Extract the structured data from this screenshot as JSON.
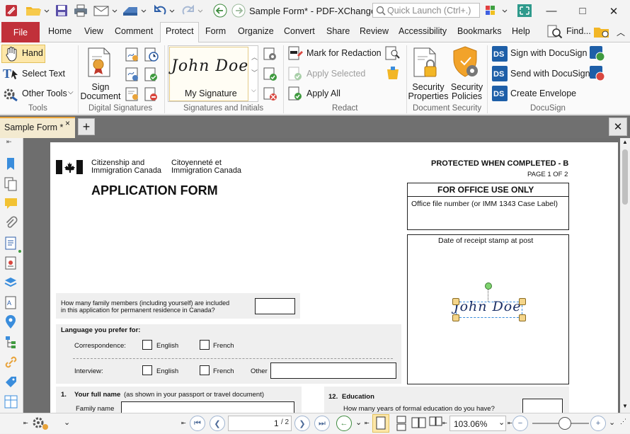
{
  "window": {
    "title": "Sample Form* - PDF-XChange ..",
    "quick_launch_placeholder": "Quick Launch (Ctrl+.)",
    "minimize": "—",
    "maximize": "□",
    "close": "✕"
  },
  "menu": {
    "file": "File",
    "tabs": [
      "Home",
      "View",
      "Comment",
      "Protect",
      "Form",
      "Organize",
      "Convert",
      "Share",
      "Review",
      "Accessibility",
      "Bookmarks",
      "Help"
    ],
    "find": "Find...",
    "active_tab": "Protect"
  },
  "ribbon": {
    "tools": {
      "hand": "Hand",
      "select_text": "Select Text",
      "other_tools": "Other Tools",
      "label": "Tools"
    },
    "digital_signatures": {
      "sign_document": "Sign Document",
      "label": "Digital Signatures"
    },
    "signatures": {
      "my_signature": "My Signature",
      "preview_text": "John Doe",
      "label": "Signatures and Initials"
    },
    "redact": {
      "mark": "Mark for Redaction",
      "apply_selected": "Apply Selected",
      "apply_all": "Apply All",
      "label": "Redact"
    },
    "security": {
      "properties": "Security Properties",
      "policies": "Security Policies",
      "label": "Document Security"
    },
    "docusign": {
      "sign": "Sign with DocuSign",
      "send": "Send with DocuSign",
      "create": "Create Envelope",
      "label": "DocuSign"
    }
  },
  "doc_tab": {
    "name": "Sample Form *",
    "close": "×",
    "new_tab": "+",
    "close_all": "✕"
  },
  "form": {
    "dept_en_1": "Citizenship and",
    "dept_en_2": "Immigration Canada",
    "dept_fr_1": "Citoyenneté et",
    "dept_fr_2": "Immigration Canada",
    "title": "APPLICATION FORM",
    "protected": "PROTECTED WHEN COMPLETED - B",
    "page": "PAGE 1 OF 2",
    "office_use": "FOR OFFICE USE ONLY",
    "office_file": "Office file number (or IMM 1343 Case Label)",
    "receipt_stamp": "Date of receipt stamp at post",
    "signature_text": "John Doe",
    "family_q_1": "How many family members (including yourself) are included",
    "family_q_2": "in this application for permanent residence in Canada?",
    "language_label": "Language you prefer for:",
    "correspondence": "Correspondence:",
    "interview": "Interview:",
    "english": "English",
    "french": "French",
    "other": "Other",
    "q1_num": "1.",
    "q1_title": "Your full name",
    "q1_note": "(as shown in your passport or travel document)",
    "family_name": "Family name",
    "q12_num": "12.",
    "q12_title": "Education",
    "q12_sub": "How many years of formal education do you have?"
  },
  "status": {
    "page_input": "1",
    "page_total": "/ 2",
    "zoom": "103.06%",
    "zoom_level": 0.57
  }
}
